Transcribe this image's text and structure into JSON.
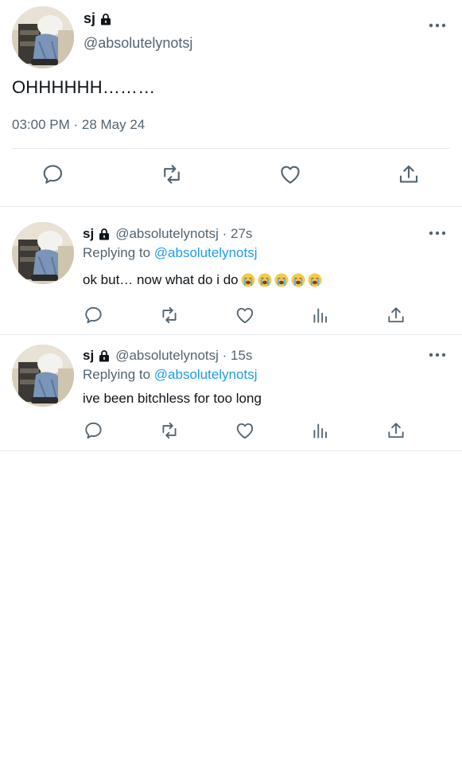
{
  "main_tweet": {
    "display_name": "sj",
    "handle": "@absolutelynotsj",
    "text": "OHHHHHH………",
    "timestamp": "03:00 PM · 28 May 24",
    "actions": [
      "reply-icon",
      "retweet-icon",
      "like-icon",
      "share-icon"
    ]
  },
  "replies": [
    {
      "display_name": "sj",
      "meta": "@absolutelynotsj · 27s",
      "replying_prefix": "Replying to ",
      "replying_to": "@absolutelynotsj",
      "text": "ok but… now what do i do",
      "emoji": "😭😭😭😭😭",
      "actions": [
        "reply-icon",
        "retweet-icon",
        "like-icon",
        "analytics-icon",
        "share-icon"
      ]
    },
    {
      "display_name": "sj",
      "meta": "@absolutelynotsj · 15s",
      "replying_prefix": "Replying to ",
      "replying_to": "@absolutelynotsj",
      "text": "ive been bitchless for too long",
      "actions": [
        "reply-icon",
        "retweet-icon",
        "like-icon",
        "analytics-icon",
        "share-icon"
      ]
    }
  ],
  "colors": {
    "text": "#0f1419",
    "secondary": "#536471",
    "link": "#1d9bf0",
    "divider": "#e6e9eb",
    "icon": "#536471"
  }
}
